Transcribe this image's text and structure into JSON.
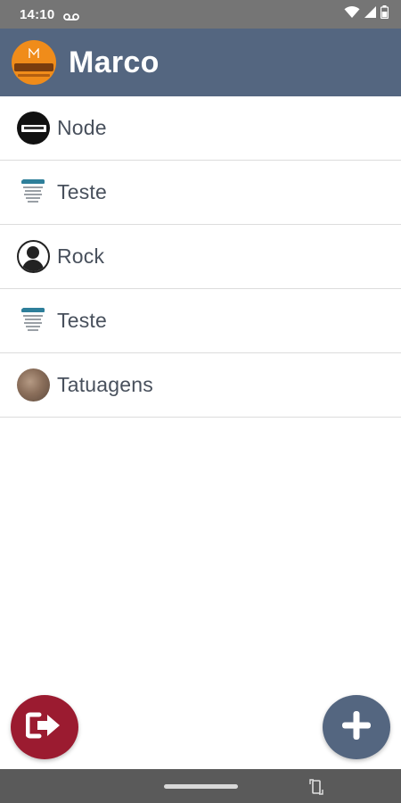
{
  "status_bar": {
    "time": "14:10"
  },
  "app_bar": {
    "title": "Marco",
    "avatar_color": "#f08c1a",
    "background": "#546680"
  },
  "list": {
    "items": [
      {
        "label": "Node",
        "avatar": "node-logo"
      },
      {
        "label": "Teste",
        "avatar": "jnes-flyer"
      },
      {
        "label": "Rock",
        "avatar": "person-placeholder"
      },
      {
        "label": "Teste",
        "avatar": "jnes-flyer"
      },
      {
        "label": "Tatuagens",
        "avatar": "tattoo-photo"
      }
    ]
  },
  "fabs": {
    "exit": {
      "icon": "exit-arrow-icon",
      "color": "#9b1b30"
    },
    "add": {
      "icon": "plus-icon",
      "color": "#546680"
    }
  }
}
